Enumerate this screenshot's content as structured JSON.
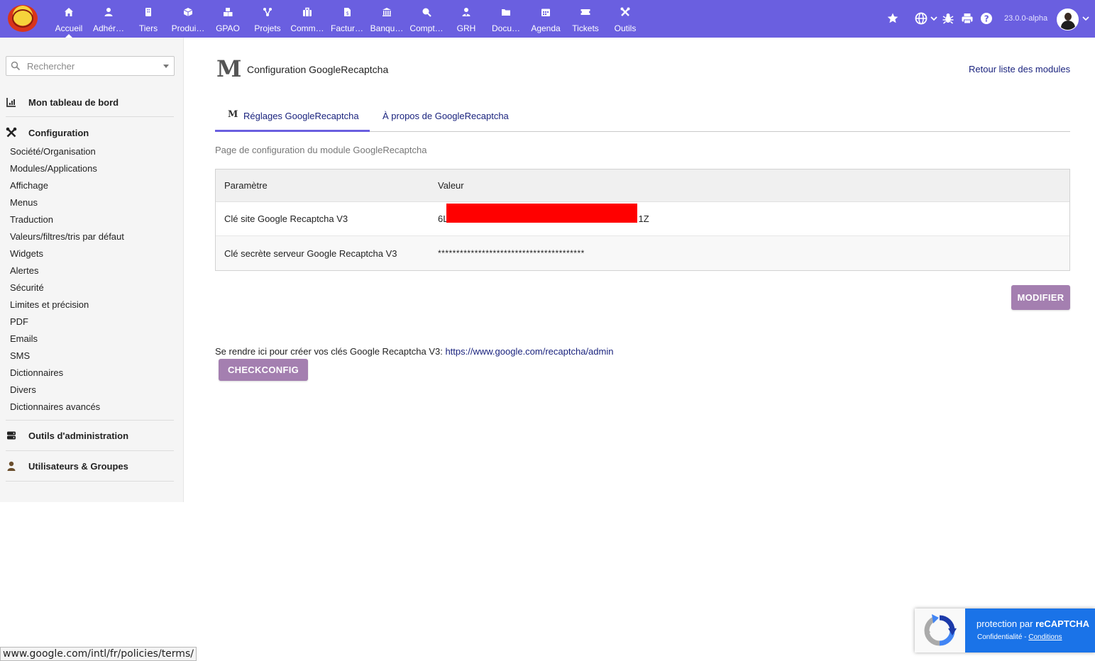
{
  "topbar": {
    "menu": [
      {
        "label": "Accueil",
        "icon": "home-icon"
      },
      {
        "label": "Adhér…",
        "icon": "member-icon"
      },
      {
        "label": "Tiers",
        "icon": "building-icon"
      },
      {
        "label": "Produi…",
        "icon": "cube-icon"
      },
      {
        "label": "GPAO",
        "icon": "cubes-icon"
      },
      {
        "label": "Projets",
        "icon": "project-icon"
      },
      {
        "label": "Comm…",
        "icon": "suitcase-icon"
      },
      {
        "label": "Factur…",
        "icon": "invoice-icon"
      },
      {
        "label": "Banqu…",
        "icon": "bank-icon"
      },
      {
        "label": "Compt…",
        "icon": "search-dollar-icon"
      },
      {
        "label": "GRH",
        "icon": "user-tie-icon"
      },
      {
        "label": "Docu…",
        "icon": "folder-icon"
      },
      {
        "label": "Agenda",
        "icon": "calendar-icon"
      },
      {
        "label": "Tickets",
        "icon": "ticket-icon"
      },
      {
        "label": "Outils",
        "icon": "tools-icon"
      }
    ],
    "version": "23.0.0-alpha",
    "accent": "#6a5fe0"
  },
  "sidebar": {
    "search_placeholder": "Rechercher",
    "dashboard_label": "Mon tableau de bord",
    "config_label": "Configuration",
    "config_links": [
      "Société/Organisation",
      "Modules/Applications",
      "Affichage",
      "Menus",
      "Traduction",
      "Valeurs/filtres/tris par défaut",
      "Widgets",
      "Alertes",
      "Sécurité",
      "Limites et précision",
      "PDF",
      "Emails",
      "SMS",
      "Dictionnaires",
      "Divers",
      "Dictionnaires avancés"
    ],
    "admin_tools_label": "Outils d'administration",
    "users_groups_label": "Utilisateurs & Groupes"
  },
  "main": {
    "module_logo": "M",
    "title": "Configuration GoogleRecaptcha",
    "back_link": "Retour liste des modules",
    "tabs": [
      {
        "icon_text": "M",
        "label": "Réglages GoogleRecaptcha"
      },
      {
        "label": "À propos de GoogleRecaptcha"
      }
    ],
    "subtitle": "Page de configuration du module GoogleRecaptcha",
    "table": {
      "headers": [
        "Paramètre",
        "Valeur"
      ],
      "rows": [
        {
          "param": "Clé site Google Recaptcha V3",
          "value_start": "6L",
          "value_end": "1Z"
        },
        {
          "param": "Clé secrète serveur Google Recaptcha V3",
          "value": "****************************************"
        }
      ]
    },
    "modify_button": "MODIFIER",
    "help_text": "Se rendre ici pour créer vos clés Google Recaptcha V3: ",
    "help_link": "https://www.google.com/recaptcha/admin",
    "checkconfig_button": "CHECKCONFIG",
    "button_color": "#a47fb0"
  },
  "statusbar": {
    "url": "www.google.com/intl/fr/policies/terms/"
  },
  "recaptcha": {
    "title_prefix": "protection par ",
    "title_brand": "reCAPTCHA",
    "privacy": "Confidentialité",
    "separator": " - ",
    "terms": "Conditions",
    "color": "#1a73e8"
  }
}
